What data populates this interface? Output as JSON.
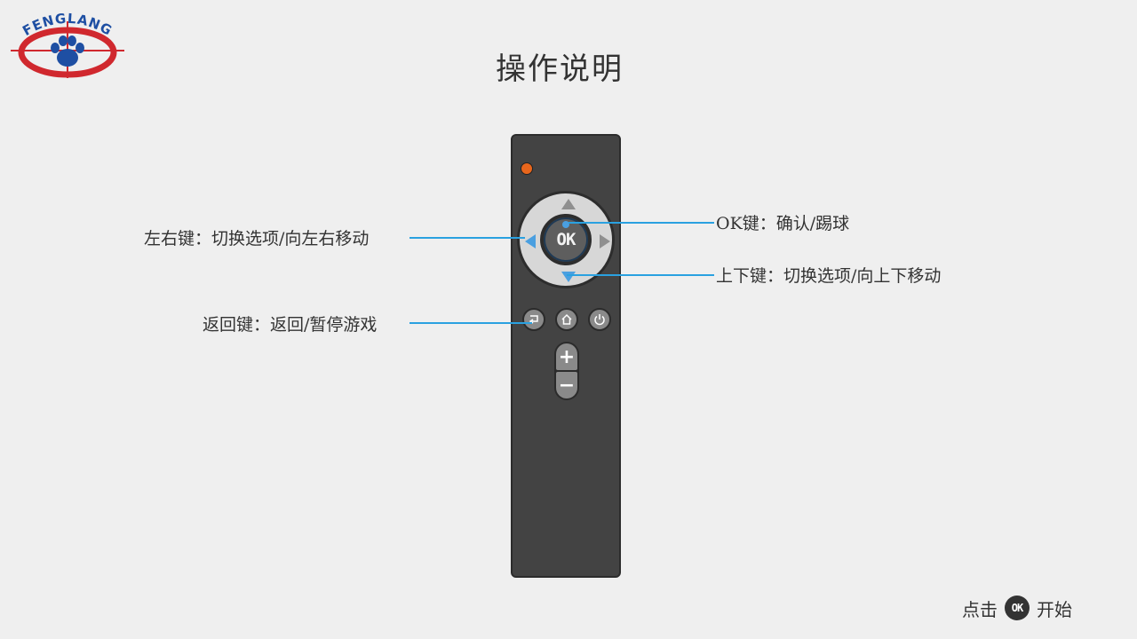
{
  "logo": {
    "text": "FENGLANG",
    "ring_color": "#d0282e",
    "text_color": "#1e4fa3"
  },
  "title": "操作说明",
  "remote": {
    "ok_label": "OK",
    "volume_up": "+",
    "volume_down": "−",
    "led_color": "#e8661c",
    "accent_color": "#2aa1e0"
  },
  "callouts": {
    "left_right": "左右键：切换选项/向左右移动",
    "ok": "OK键：确认/踢球",
    "up_down": "上下键：切换选项/向上下移动",
    "back": "返回键：返回/暂停游戏"
  },
  "footer": {
    "prefix": "点击",
    "ok": "OK",
    "suffix": "开始"
  },
  "icons": [
    "back-icon",
    "home-icon",
    "power-icon"
  ]
}
